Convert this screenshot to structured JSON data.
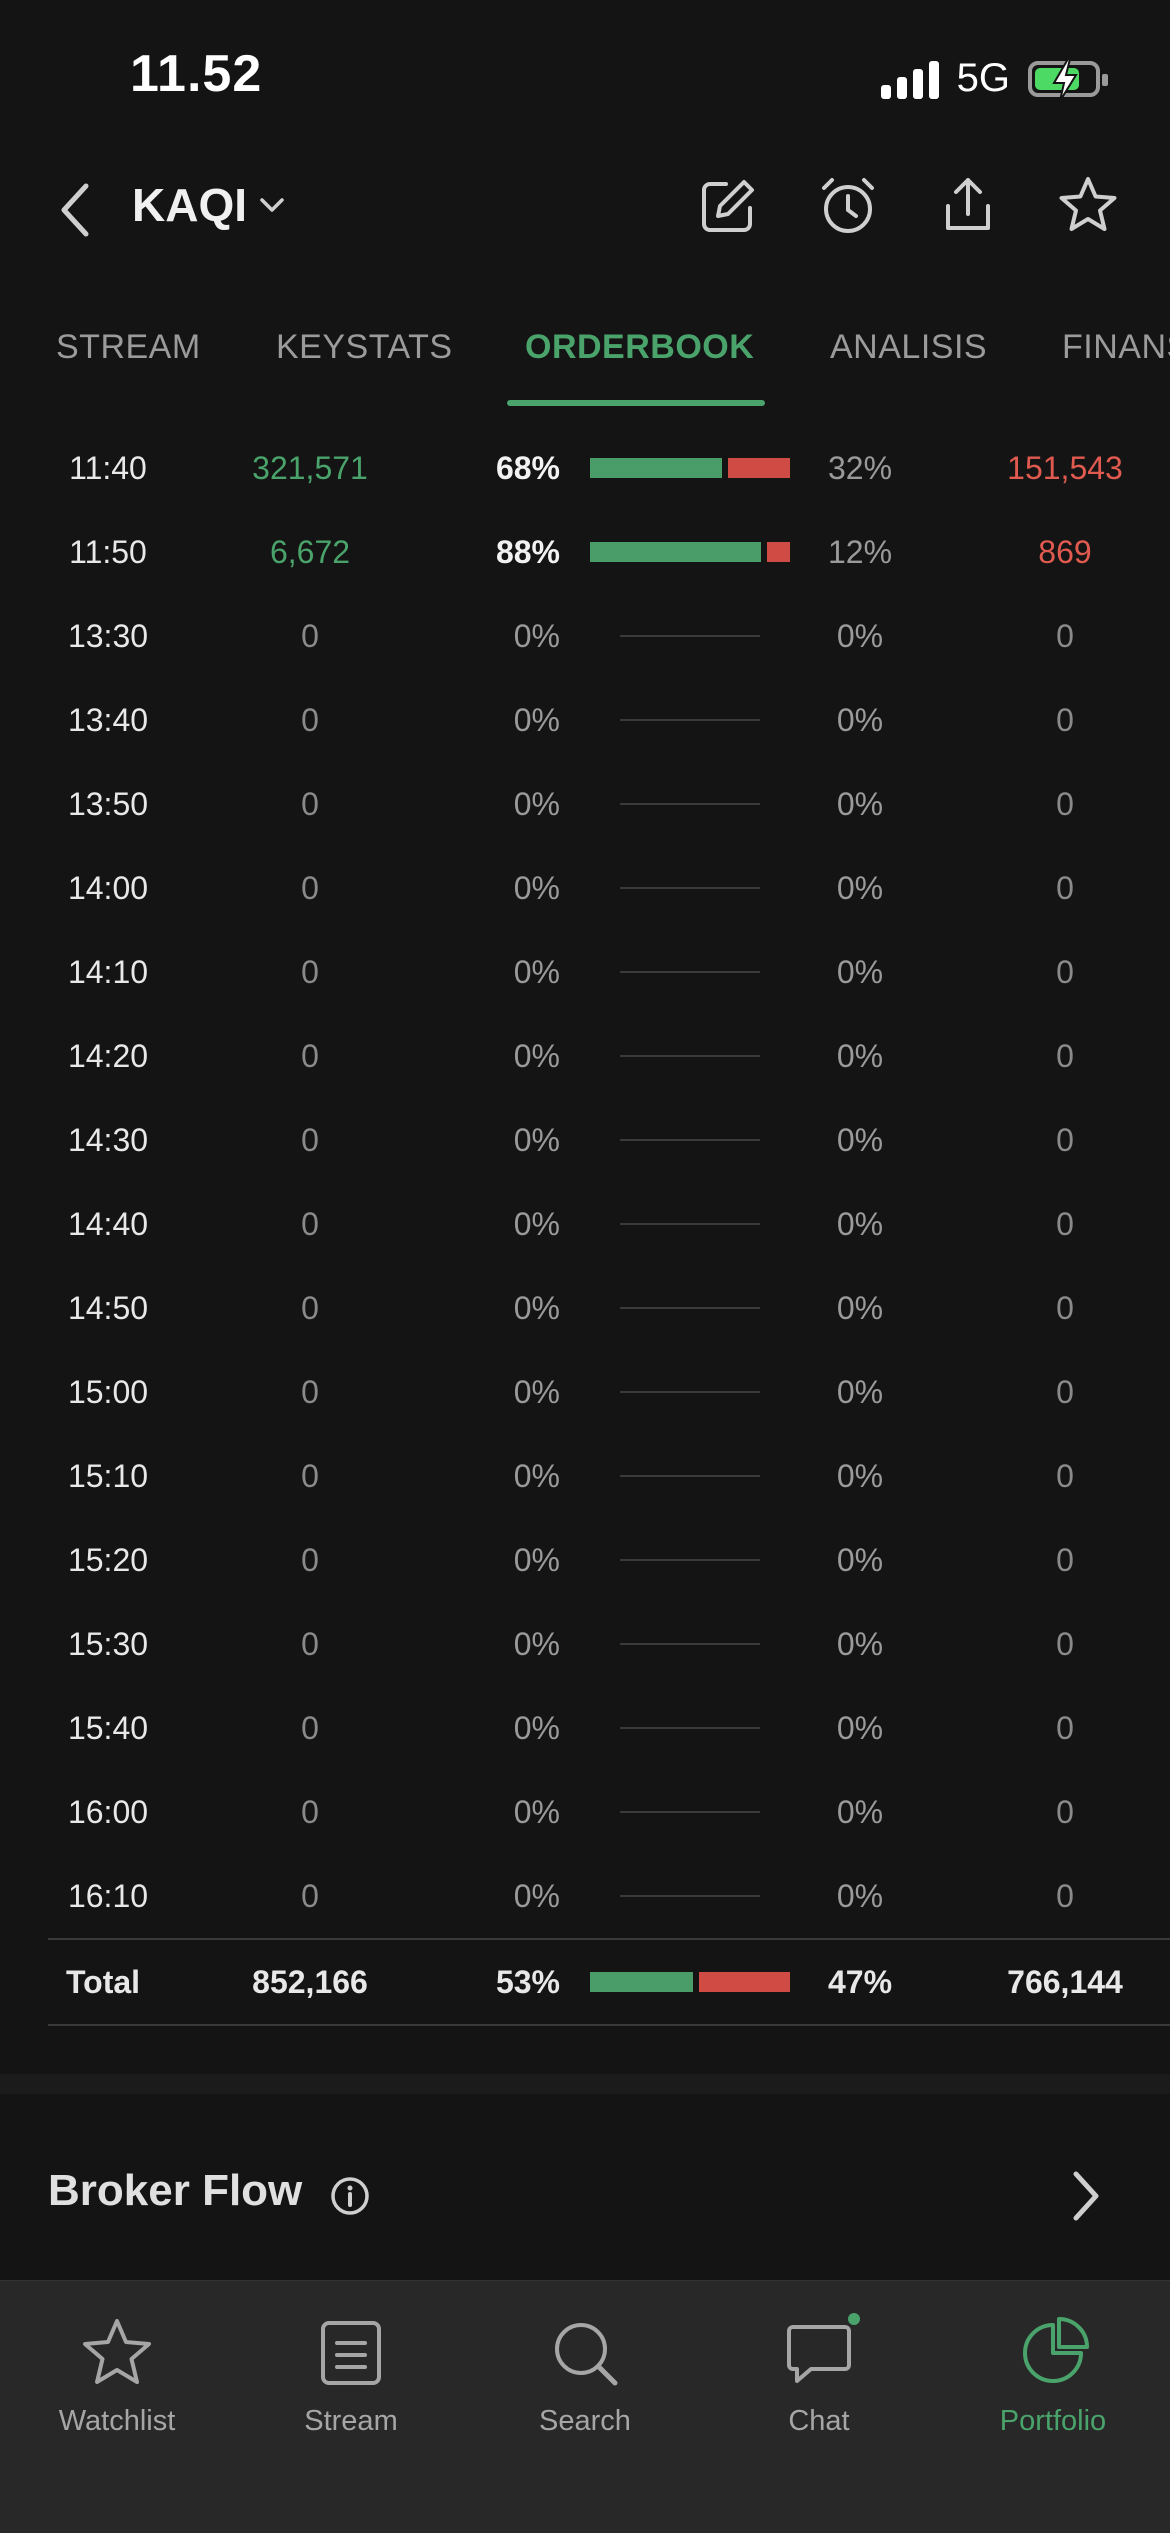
{
  "status_bar": {
    "time": "11.52",
    "network": "5G",
    "battery_charging": true
  },
  "header": {
    "ticker": "KAQI"
  },
  "tabs": [
    {
      "label": "STREAM",
      "active": false
    },
    {
      "label": "KEYSTATS",
      "active": false
    },
    {
      "label": "ORDERBOOK",
      "active": true
    },
    {
      "label": "ANALISIS",
      "active": false
    },
    {
      "label": "FINANS",
      "active": false
    }
  ],
  "orderbook": {
    "rows": [
      {
        "time": "11:40",
        "buy": "321,571",
        "buy_pct": "68%",
        "sell_pct": "32%",
        "sell": "151,543",
        "buy_frac": 0.68,
        "active": true
      },
      {
        "time": "11:50",
        "buy": "6,672",
        "buy_pct": "88%",
        "sell_pct": "12%",
        "sell": "869",
        "buy_frac": 0.88,
        "active": true
      },
      {
        "time": "13:30",
        "buy": "0",
        "buy_pct": "0%",
        "sell_pct": "0%",
        "sell": "0",
        "active": false
      },
      {
        "time": "13:40",
        "buy": "0",
        "buy_pct": "0%",
        "sell_pct": "0%",
        "sell": "0",
        "active": false
      },
      {
        "time": "13:50",
        "buy": "0",
        "buy_pct": "0%",
        "sell_pct": "0%",
        "sell": "0",
        "active": false
      },
      {
        "time": "14:00",
        "buy": "0",
        "buy_pct": "0%",
        "sell_pct": "0%",
        "sell": "0",
        "active": false
      },
      {
        "time": "14:10",
        "buy": "0",
        "buy_pct": "0%",
        "sell_pct": "0%",
        "sell": "0",
        "active": false
      },
      {
        "time": "14:20",
        "buy": "0",
        "buy_pct": "0%",
        "sell_pct": "0%",
        "sell": "0",
        "active": false
      },
      {
        "time": "14:30",
        "buy": "0",
        "buy_pct": "0%",
        "sell_pct": "0%",
        "sell": "0",
        "active": false
      },
      {
        "time": "14:40",
        "buy": "0",
        "buy_pct": "0%",
        "sell_pct": "0%",
        "sell": "0",
        "active": false
      },
      {
        "time": "14:50",
        "buy": "0",
        "buy_pct": "0%",
        "sell_pct": "0%",
        "sell": "0",
        "active": false
      },
      {
        "time": "15:00",
        "buy": "0",
        "buy_pct": "0%",
        "sell_pct": "0%",
        "sell": "0",
        "active": false
      },
      {
        "time": "15:10",
        "buy": "0",
        "buy_pct": "0%",
        "sell_pct": "0%",
        "sell": "0",
        "active": false
      },
      {
        "time": "15:20",
        "buy": "0",
        "buy_pct": "0%",
        "sell_pct": "0%",
        "sell": "0",
        "active": false
      },
      {
        "time": "15:30",
        "buy": "0",
        "buy_pct": "0%",
        "sell_pct": "0%",
        "sell": "0",
        "active": false
      },
      {
        "time": "15:40",
        "buy": "0",
        "buy_pct": "0%",
        "sell_pct": "0%",
        "sell": "0",
        "active": false
      },
      {
        "time": "16:00",
        "buy": "0",
        "buy_pct": "0%",
        "sell_pct": "0%",
        "sell": "0",
        "active": false
      },
      {
        "time": "16:10",
        "buy": "0",
        "buy_pct": "0%",
        "sell_pct": "0%",
        "sell": "0",
        "active": false
      }
    ],
    "total": {
      "label": "Total",
      "buy": "852,166",
      "buy_pct": "53%",
      "sell_pct": "47%",
      "sell": "766,144",
      "buy_frac": 0.53
    }
  },
  "broker_flow": {
    "title": "Broker Flow"
  },
  "bottom_tabs": [
    {
      "label": "Watchlist",
      "icon": "star-icon",
      "active": false
    },
    {
      "label": "Stream",
      "icon": "stream-icon",
      "active": false
    },
    {
      "label": "Search",
      "icon": "search-icon",
      "active": false
    },
    {
      "label": "Chat",
      "icon": "chat-icon",
      "active": false,
      "badge": true
    },
    {
      "label": "Portfolio",
      "icon": "pie-chart-icon",
      "active": true
    }
  ],
  "colors": {
    "accent": "#4aa36b",
    "buy": "#4a9d68",
    "sell": "#cf4b44",
    "background": "#141414"
  }
}
